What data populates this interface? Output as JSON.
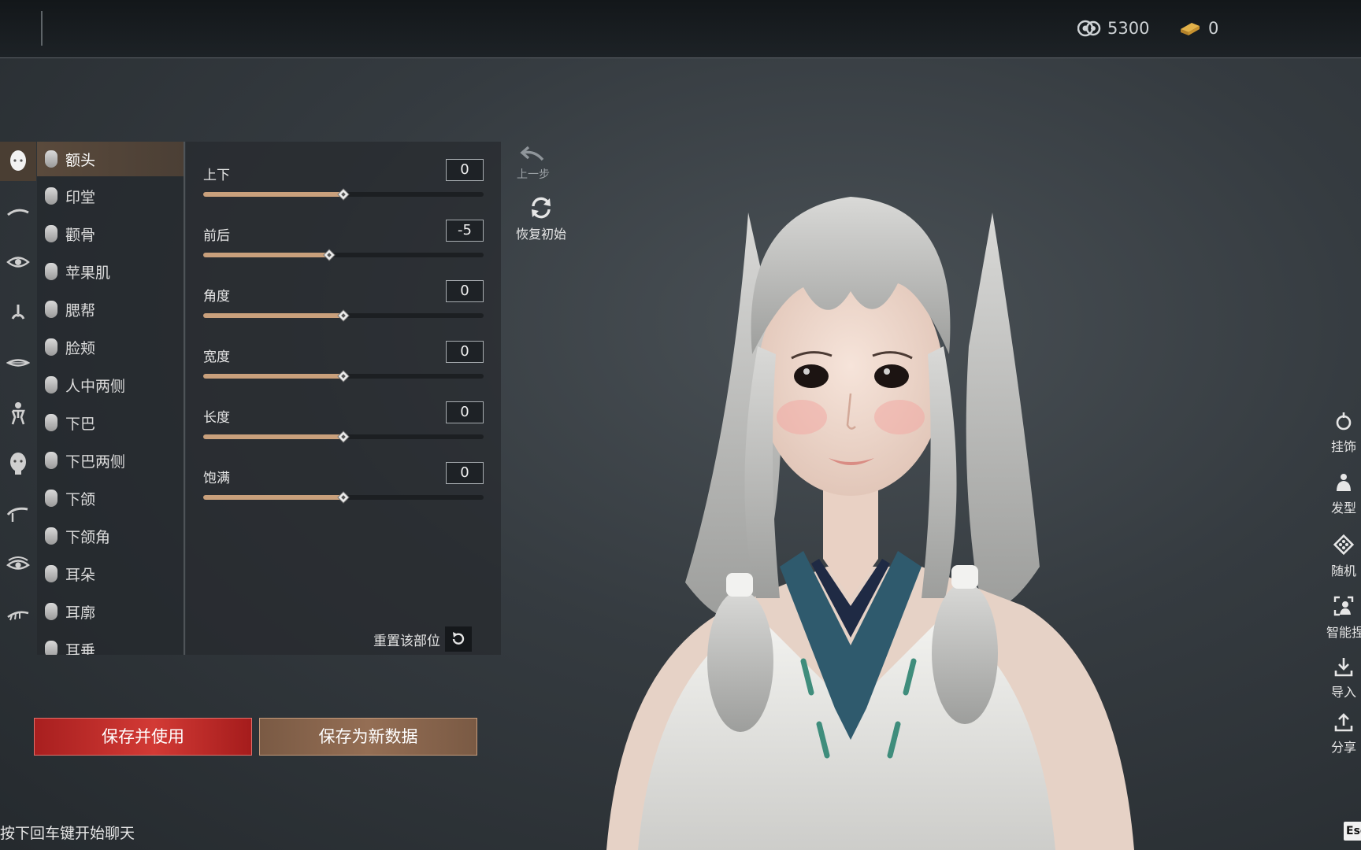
{
  "currency": [
    {
      "icon": "coin-swirl-icon",
      "value": "5300"
    },
    {
      "icon": "gold-ingot-icon",
      "value": "0"
    }
  ],
  "categories": [
    {
      "icon": "face-icon",
      "active": true
    },
    {
      "icon": "eyebrow-icon",
      "active": false
    },
    {
      "icon": "eye-icon",
      "active": false
    },
    {
      "icon": "nose-icon",
      "active": false
    },
    {
      "icon": "mouth-icon",
      "active": false
    },
    {
      "icon": "body-icon",
      "active": false
    },
    {
      "icon": "head-profile-icon",
      "active": false
    },
    {
      "icon": "brush-icon",
      "active": false
    },
    {
      "icon": "eye-makeup-icon",
      "active": false
    },
    {
      "icon": "lash-icon",
      "active": false
    }
  ],
  "parts": [
    {
      "label": "额头",
      "active": true
    },
    {
      "label": "印堂",
      "active": false
    },
    {
      "label": "颧骨",
      "active": false
    },
    {
      "label": "苹果肌",
      "active": false
    },
    {
      "label": "腮帮",
      "active": false
    },
    {
      "label": "脸颊",
      "active": false
    },
    {
      "label": "人中两侧",
      "active": false
    },
    {
      "label": "下巴",
      "active": false
    },
    {
      "label": "下巴两侧",
      "active": false
    },
    {
      "label": "下颌",
      "active": false
    },
    {
      "label": "下颌角",
      "active": false
    },
    {
      "label": "耳朵",
      "active": false
    },
    {
      "label": "耳廓",
      "active": false
    },
    {
      "label": "耳垂",
      "active": false
    }
  ],
  "sliders": {
    "min": -50,
    "max": 50,
    "items": [
      {
        "label": "上下",
        "value": "0"
      },
      {
        "label": "前后",
        "value": "-5"
      },
      {
        "label": "角度",
        "value": "0"
      },
      {
        "label": "宽度",
        "value": "0"
      },
      {
        "label": "长度",
        "value": "0"
      },
      {
        "label": "饱满",
        "value": "0"
      }
    ]
  },
  "reset_part_label": "重置该部位",
  "undo_label": "上一步",
  "restore_label": "恢复初始",
  "buttons": {
    "save_use": "保存并使用",
    "save_new": "保存为新数据"
  },
  "chat_hint": "按下回车键开始聊天",
  "right_tools": [
    {
      "icon": "accessory-icon",
      "label": "挂饰"
    },
    {
      "icon": "hairstyle-icon",
      "label": "发型"
    },
    {
      "icon": "random-dice-icon",
      "label": "随机"
    },
    {
      "icon": "smart-capture-icon",
      "label": "智能捏"
    },
    {
      "icon": "import-icon",
      "label": "导入"
    },
    {
      "icon": "share-icon",
      "label": "分享"
    }
  ],
  "esc_label": "Esc",
  "colors": {
    "accent_copper": "#c9a07c",
    "save_red": "#c62f2b",
    "save_brown": "#8a664d"
  }
}
